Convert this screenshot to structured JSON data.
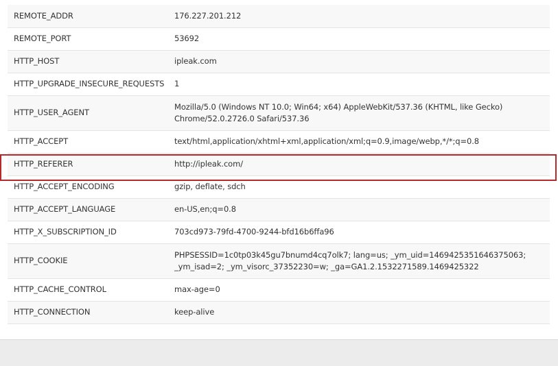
{
  "rows": [
    {
      "key": "REMOTE_ADDR",
      "value": "176.227.201.212"
    },
    {
      "key": "REMOTE_PORT",
      "value": "53692"
    },
    {
      "key": "HTTP_HOST",
      "value": "ipleak.com"
    },
    {
      "key": "HTTP_UPGRADE_INSECURE_REQUESTS",
      "value": "1"
    },
    {
      "key": "HTTP_USER_AGENT",
      "value": "Mozilla/5.0 (Windows NT 10.0; Win64; x64) AppleWebKit/537.36 (KHTML, like Gecko) Chrome/52.0.2726.0 Safari/537.36"
    },
    {
      "key": "HTTP_ACCEPT",
      "value": "text/html,application/xhtml+xml,application/xml;q=0.9,image/webp,*/*;q=0.8"
    },
    {
      "key": "HTTP_REFERER",
      "value": "http://ipleak.com/"
    },
    {
      "key": "HTTP_ACCEPT_ENCODING",
      "value": "gzip, deflate, sdch"
    },
    {
      "key": "HTTP_ACCEPT_LANGUAGE",
      "value": "en-US,en;q=0.8"
    },
    {
      "key": "HTTP_X_SUBSCRIPTION_ID",
      "value": "703cd973-79fd-4700-9244-bfd16b6ffa96"
    },
    {
      "key": "HTTP_COOKIE",
      "value": "PHPSESSID=1c0tp03k45gu7bnumd4cq7olk7; lang=us; _ym_uid=1469425351646375063; _ym_isad=2; _ym_visorc_37352230=w; _ga=GA1.2.1532271589.1469425322"
    },
    {
      "key": "HTTP_CACHE_CONTROL",
      "value": "max-age=0"
    },
    {
      "key": "HTTP_CONNECTION",
      "value": "keep-alive"
    }
  ],
  "colors": {
    "highlight_border": "#b42a2a",
    "row_alt": "#f8f8f8",
    "footer": "#ececec"
  }
}
